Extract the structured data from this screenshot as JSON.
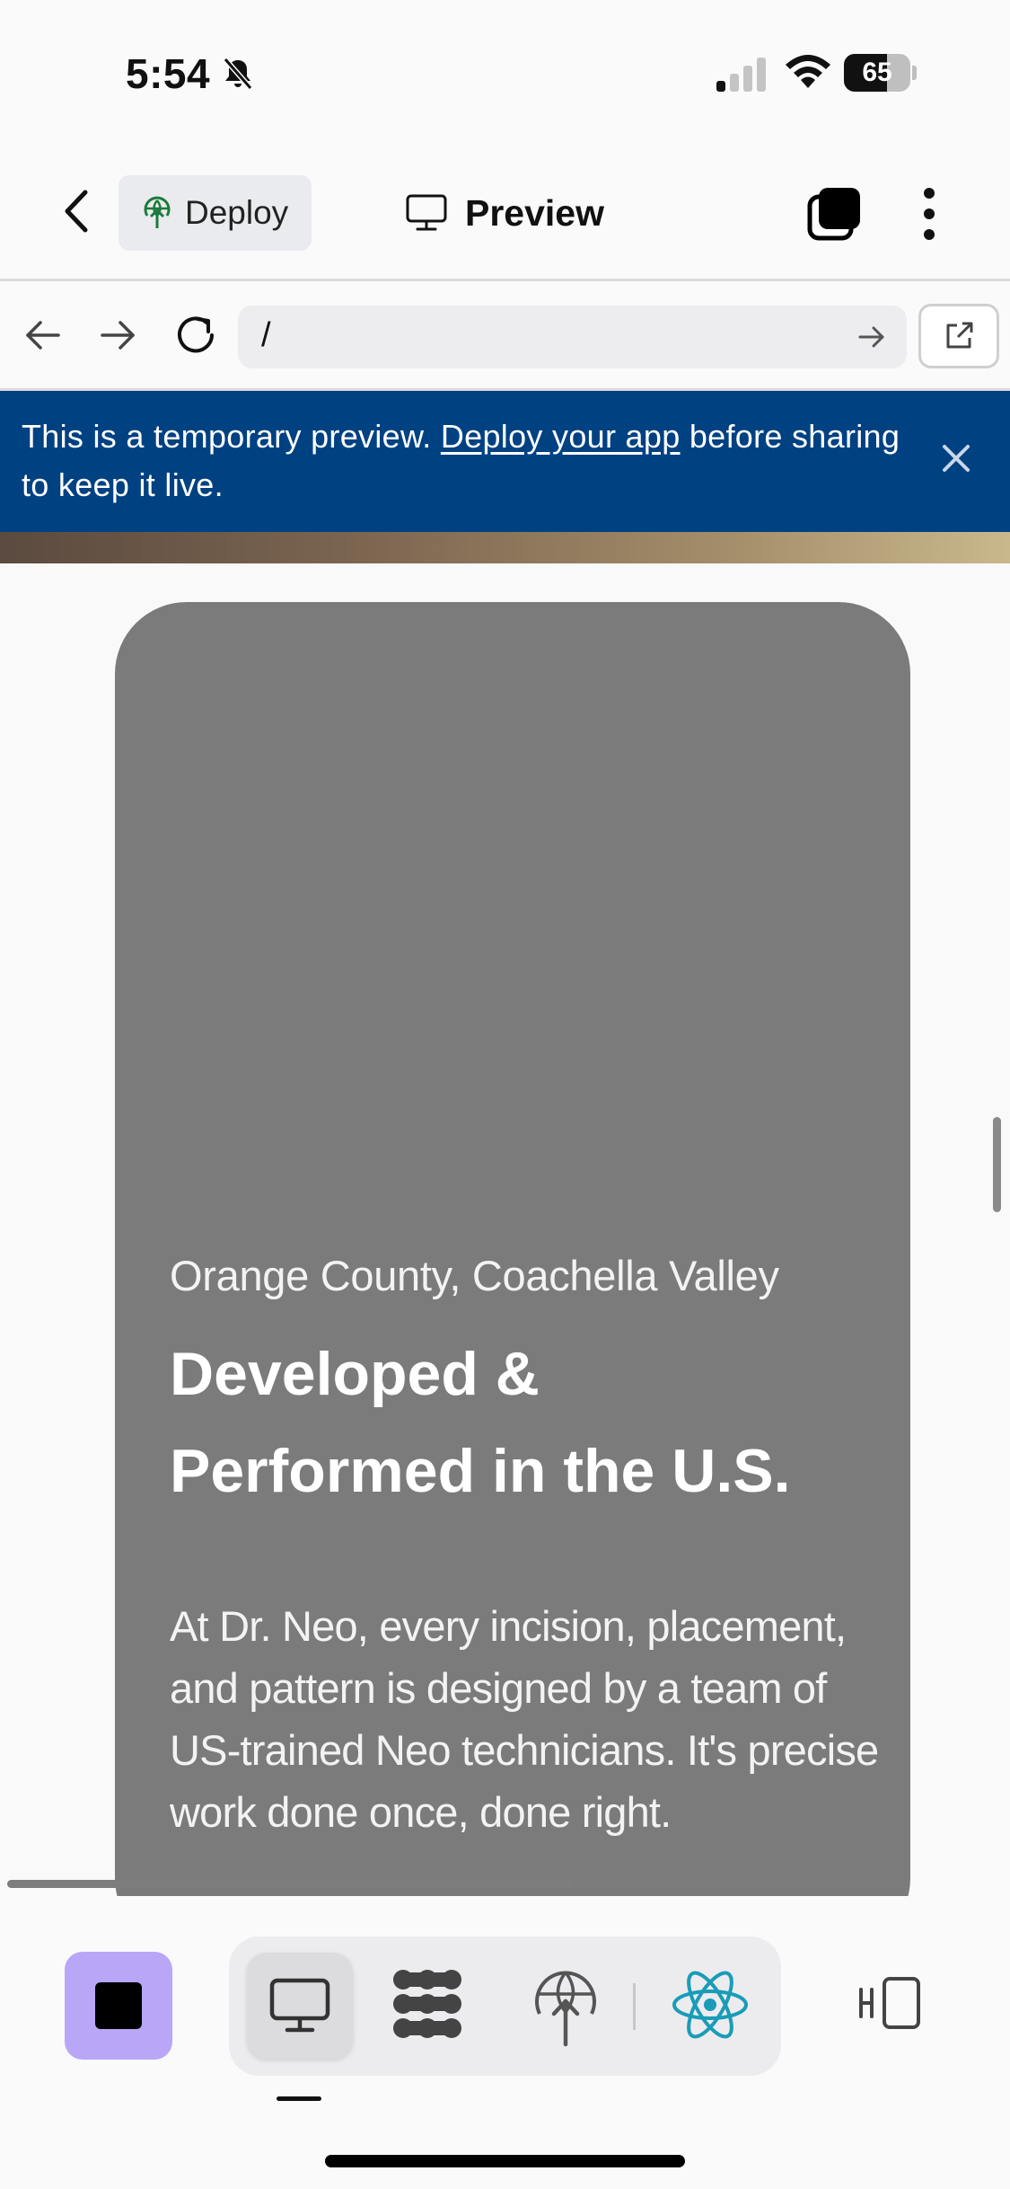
{
  "status_bar": {
    "time": "5:54",
    "battery_level": "65",
    "battery_fraction": 0.65,
    "icons": [
      "bell-slash-icon",
      "cellular-signal-icon",
      "wifi-icon",
      "battery-icon"
    ]
  },
  "header": {
    "deploy_label": "Deploy",
    "preview_label": "Preview",
    "icons": [
      "chevron-left-icon",
      "deploy-icon",
      "monitor-icon",
      "tabs-icon",
      "more-vertical-icon"
    ]
  },
  "url_bar": {
    "url": "/",
    "icons": [
      "arrow-left-icon",
      "arrow-right-icon",
      "reload-icon",
      "go-arrow-icon",
      "open-external-icon"
    ]
  },
  "banner": {
    "text_before": "This is a temporary preview. ",
    "link_text": "Deploy your app",
    "text_after": " before sharing to keep it live.",
    "background": "#004182"
  },
  "hero": {
    "location": "Orange County, Coachella Valley",
    "heading": "Developed & Performed in the U.S.",
    "body": "At Dr. Neo, every incision, placement, and pattern is designed by a team of US-trained Neo technicians. It's precise work done once, done right.",
    "card_color": "#7b7b7b"
  },
  "toolbar": {
    "stop_color": "#b9a6f7",
    "tools": [
      "monitor-icon",
      "dots-grid-icon",
      "deploy-icon",
      "react-icon"
    ],
    "sidebar_icon": "sidebar-toggle-icon",
    "react_color": "#1a9cb8"
  }
}
